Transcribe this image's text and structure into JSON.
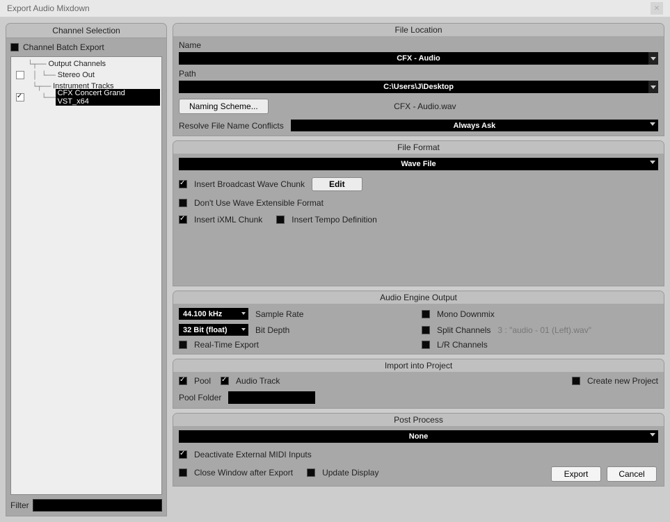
{
  "window": {
    "title": "Export Audio Mixdown"
  },
  "left": {
    "section_title": "Channel Selection",
    "batch_label": "Channel Batch Export",
    "tree": {
      "output_channels": "Output Channels",
      "stereo_out": "Stereo Out",
      "instrument_tracks": "Instrument Tracks",
      "cfx": "CFX Concert Grand VST_x64"
    },
    "filter_label": "Filter"
  },
  "file_location": {
    "title": "File Location",
    "name_label": "Name",
    "name_value": "CFX - Audio",
    "path_label": "Path",
    "path_value": "C:\\Users\\J\\Desktop",
    "naming_scheme_btn": "Naming Scheme...",
    "filename_preview": "CFX - Audio.wav",
    "resolve_label": "Resolve File Name Conflicts",
    "resolve_value": "Always Ask"
  },
  "file_format": {
    "title": "File Format",
    "value": "Wave File",
    "broadcast_label": "Insert Broadcast Wave Chunk",
    "edit_btn": "Edit",
    "no_wave_ext_label": "Don't Use Wave Extensible Format",
    "ixml_label": "Insert iXML Chunk",
    "tempo_label": "Insert Tempo Definition"
  },
  "audio_engine": {
    "title": "Audio Engine Output",
    "sample_rate_value": "44.100 kHz",
    "sample_rate_label": "Sample Rate",
    "bit_depth_value": "32 Bit (float)",
    "bit_depth_label": "Bit Depth",
    "realtime_label": "Real-Time Export",
    "mono_label": "Mono Downmix",
    "split_label": "Split Channels",
    "split_scheme": "3 : \"audio - 01 (Left).wav\"",
    "lr_label": "L/R Channels"
  },
  "import_project": {
    "title": "Import into Project",
    "pool_label": "Pool",
    "audio_track_label": "Audio Track",
    "create_project_label": "Create new Project",
    "pool_folder_label": "Pool Folder"
  },
  "post_process": {
    "title": "Post Process",
    "value": "None",
    "deactivate_midi_label": "Deactivate External MIDI Inputs",
    "close_window_label": "Close Window after Export",
    "update_display_label": "Update Display"
  },
  "buttons": {
    "export": "Export",
    "cancel": "Cancel"
  }
}
